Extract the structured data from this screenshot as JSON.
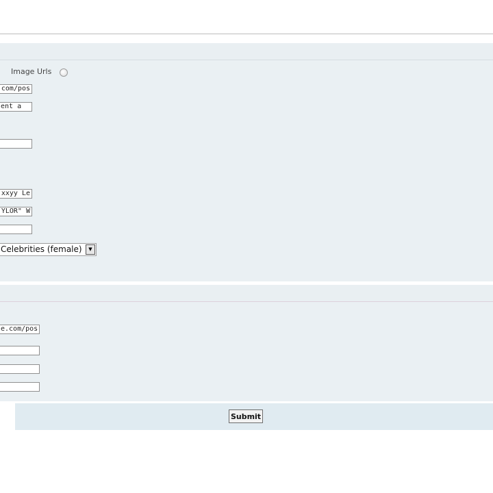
{
  "form_top": {
    "image_urls_label": "Image Urls",
    "fields": [
      "com/pos",
      "ent a",
      "",
      "xxyy Le",
      "YLOR\" W",
      ""
    ],
    "category_select": "Celebrities (female)"
  },
  "form_bottom": {
    "fields": [
      "e.com/pos",
      "",
      "",
      ""
    ]
  },
  "footer": {
    "submit_label": "Submit"
  }
}
